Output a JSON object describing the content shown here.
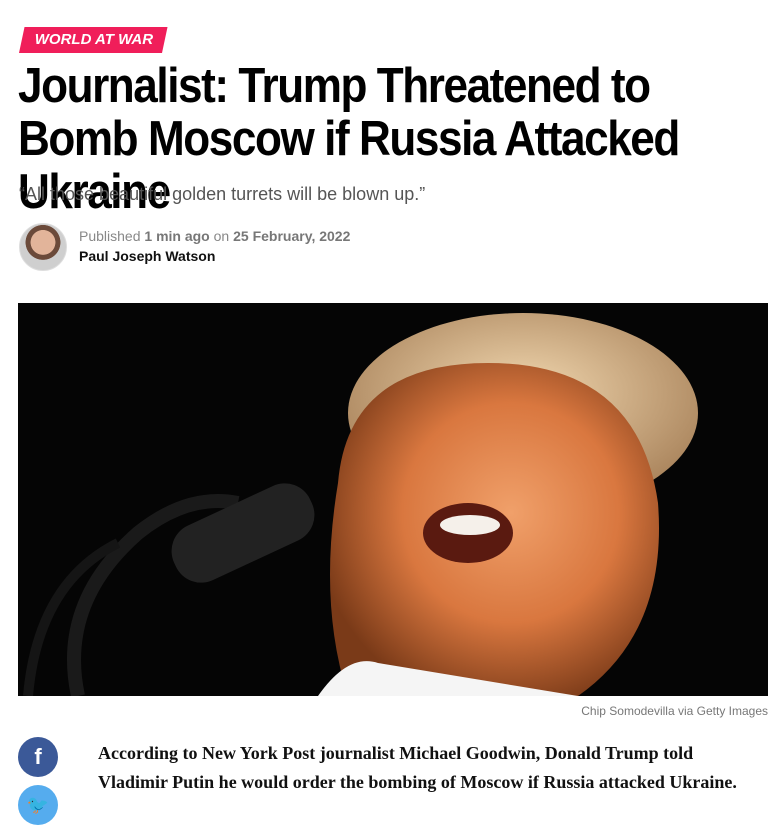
{
  "article": {
    "category": "WORLD AT WAR",
    "title": "Journalist: Trump Threatened to Bomb Moscow if Russia Attacked Ukraine",
    "subtitle": "“All those beautiful golden turrets will be blown up.”",
    "published_prefix": "Published",
    "published_time": "1 min ago",
    "published_on": "on",
    "published_date": "25 February, 2022",
    "author": "Paul Joseph Watson",
    "image_credit": "Chip Somodevilla via Getty Images",
    "lede": "According to New York Post journalist Michael Goodwin, Donald Trump told Vladimir Putin he would order the bombing of Moscow if Russia attacked Ukraine."
  },
  "share": {
    "facebook_glyph": "f",
    "twitter_glyph": "🐦"
  },
  "colors": {
    "category_bg": "#f01e5a",
    "facebook": "#3b5998",
    "twitter": "#55acee"
  }
}
